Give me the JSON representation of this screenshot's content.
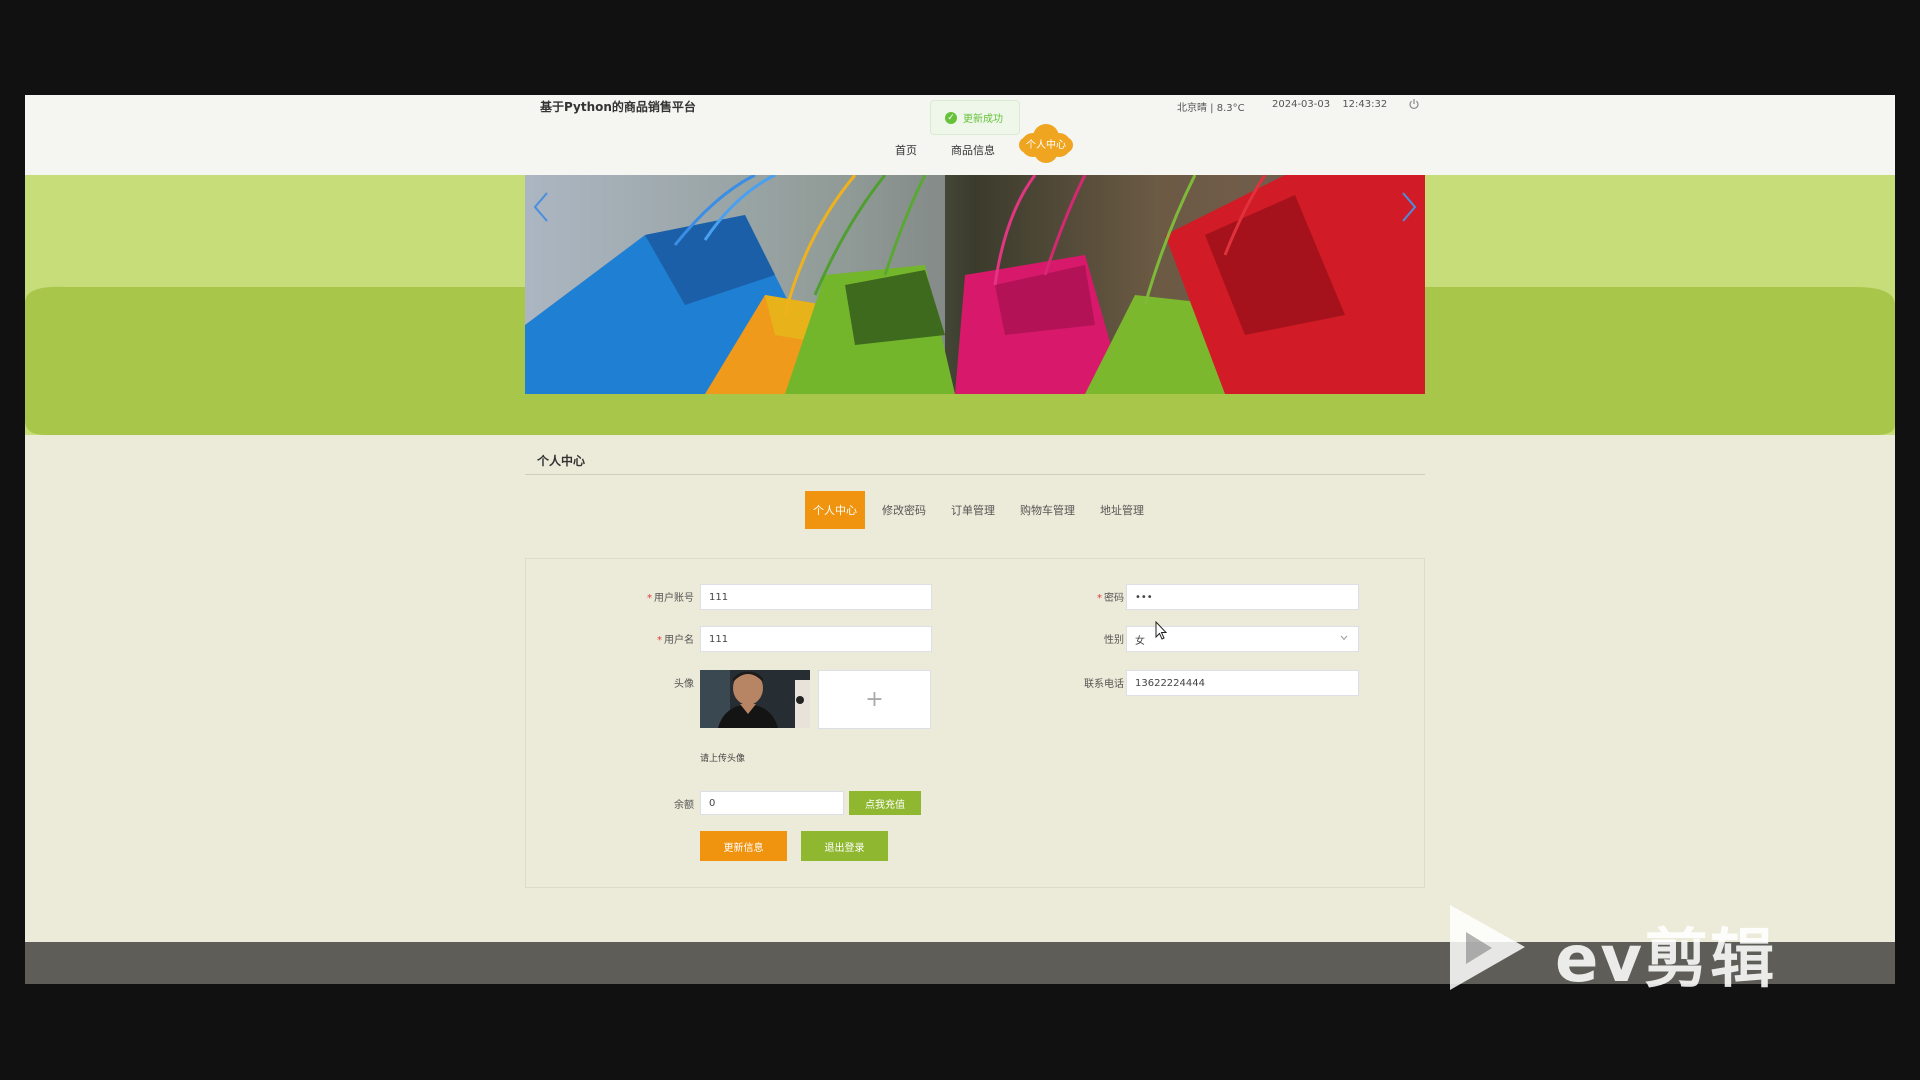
{
  "header": {
    "site_title": "基于Python的商品销售平台",
    "weather": "北京晴 | 8.3°C",
    "date": "2024-03-03",
    "time": "12:43:32",
    "power_icon": "power-icon"
  },
  "toast": {
    "message": "更新成功",
    "icon": "check-circle-icon"
  },
  "nav": {
    "items": [
      {
        "label": "首页"
      },
      {
        "label": "商品信息"
      }
    ],
    "active_label": "个人中心"
  },
  "carousel": {
    "left_icon": "chevron-left-icon",
    "right_icon": "chevron-right-icon"
  },
  "section": {
    "title": "个人中心"
  },
  "tabs": [
    {
      "label": "个人中心",
      "active": true
    },
    {
      "label": "修改密码"
    },
    {
      "label": "订单管理"
    },
    {
      "label": "购物车管理"
    },
    {
      "label": "地址管理"
    }
  ],
  "form": {
    "account_label": "用户账号",
    "account_value": "111",
    "username_label": "用户名",
    "username_value": "111",
    "avatar_label": "头像",
    "upload_hint": "请上传头像",
    "upload_icon": "plus-icon",
    "balance_label": "余额",
    "balance_value": "0",
    "recharge_label": "点我充值",
    "password_label": "密码",
    "password_value": "•••",
    "gender_label": "性别",
    "gender_value": "女",
    "phone_label": "联系电话",
    "phone_value": "13622224444",
    "required_mark": "*"
  },
  "buttons": {
    "update": "更新信息",
    "logout": "退出登录"
  },
  "watermark": {
    "text": "ev剪辑"
  },
  "colors": {
    "accent_orange": "#f0930f",
    "accent_green": "#8fb830",
    "banner_green": "#a9c94b",
    "page_bg": "#ecead8"
  }
}
